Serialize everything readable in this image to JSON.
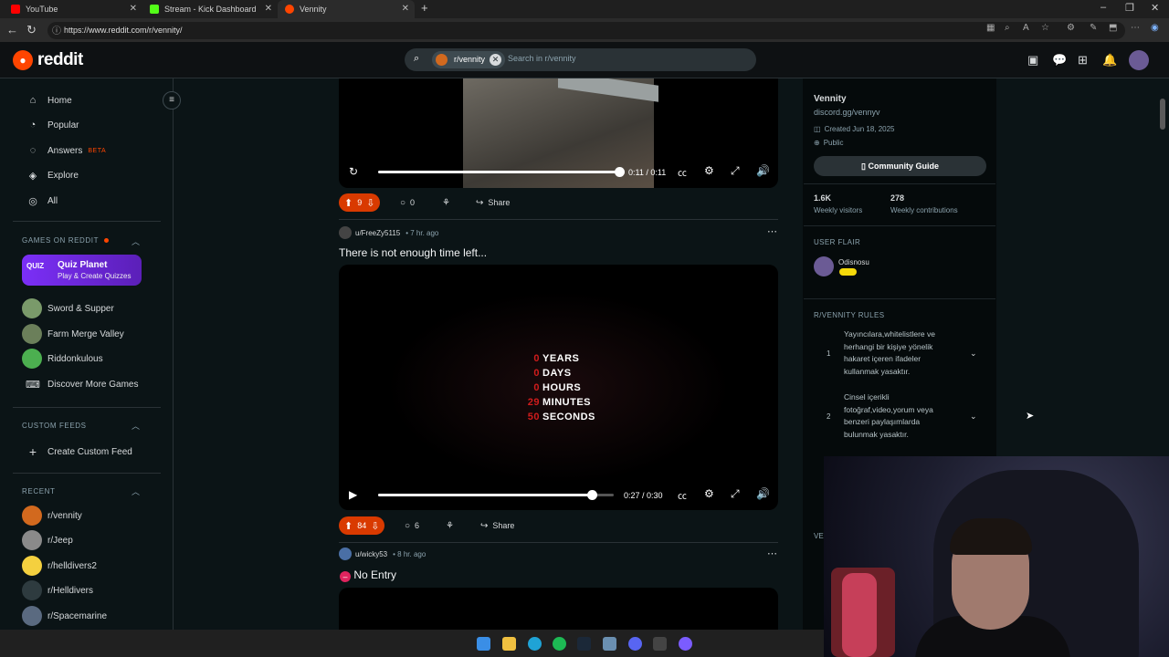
{
  "browser": {
    "tabs": [
      {
        "title": "YouTube",
        "color": "#ff0000"
      },
      {
        "title": "Stream - Kick Dashboard",
        "color": "#53fc18"
      },
      {
        "title": "Vennity",
        "color": "#ff4500"
      }
    ],
    "url": "https://www.reddit.com/r/vennity/"
  },
  "header": {
    "logo_text": "reddit",
    "search_chip": "r/vennity",
    "search_placeholder": "Search in r/vennity"
  },
  "sidebar": {
    "nav": [
      {
        "label": "Home",
        "icon": "home-icon"
      },
      {
        "label": "Popular",
        "icon": "popular-icon"
      },
      {
        "label": "Answers",
        "icon": "answers-icon",
        "badge": "BETA"
      },
      {
        "label": "Explore",
        "icon": "explore-icon"
      },
      {
        "label": "All",
        "icon": "all-icon"
      }
    ],
    "games_heading": "GAMES ON REDDIT",
    "featured_game": {
      "icon_text": "QUIZ",
      "title": "Quiz Planet",
      "subtitle": "Play & Create Quizzes"
    },
    "games": [
      "Sword & Supper",
      "Farm Merge Valley",
      "Riddonkulous"
    ],
    "discover_more": "Discover More Games",
    "custom_feeds_heading": "CUSTOM FEEDS",
    "create_feed": "Create Custom Feed",
    "recent_heading": "RECENT",
    "recent": [
      "r/vennity",
      "r/Jeep",
      "r/helldivers2",
      "r/Helldivers",
      "r/Spacemarine"
    ]
  },
  "feed": {
    "post1": {
      "time": "0:11 / 0:11",
      "upvotes": "9",
      "comments": "0",
      "share": "Share",
      "progress": 1.0
    },
    "post2": {
      "author": "u/FreeZy5115",
      "time_ago": "• 7 hr. ago",
      "title": "There is not enough time left...",
      "countdown": [
        {
          "n": "0",
          "unit": "YEARS"
        },
        {
          "n": "0",
          "unit": "DAYS"
        },
        {
          "n": "0",
          "unit": "HOURS"
        },
        {
          "n": "29",
          "unit": "MINUTES"
        },
        {
          "n": "50",
          "unit": "SECONDS"
        }
      ],
      "video_time": "0:27 / 0:30",
      "progress": 0.9,
      "upvotes": "84",
      "comments": "6",
      "share": "Share"
    },
    "post3": {
      "author": "u/wicky53",
      "time_ago": "• 8 hr. ago",
      "title": "No Entry",
      "title_icon": "no-entry-icon"
    }
  },
  "community": {
    "name": "Vennity",
    "link": "discord.gg/vennyv",
    "created": "Created Jun 18, 2025",
    "visibility": "Public",
    "guide_button": "Community Guide",
    "stats": [
      {
        "value": "1.6K",
        "label": "Weekly visitors"
      },
      {
        "value": "278",
        "label": "Weekly contributions"
      }
    ],
    "user_flair_heading": "USER FLAIR",
    "user_name": "Odisnosu",
    "rules_heading": "R/VENNITY RULES",
    "rules": [
      {
        "n": "1",
        "text": "Yayıncılara,whitelistlere ve herhangi bir kişiye yönelik hakaret içeren ifadeler kullanmak yasaktır."
      },
      {
        "n": "2",
        "text": "Cinsel içerikli fotoğraf,video,yorum veya benzeri paylaşımlarda bulunmak yasaktır."
      }
    ],
    "partial_heading": "VE"
  },
  "colors": {
    "accent": "#ff4500",
    "vote": "#d93a00",
    "background": "#0b1416"
  }
}
